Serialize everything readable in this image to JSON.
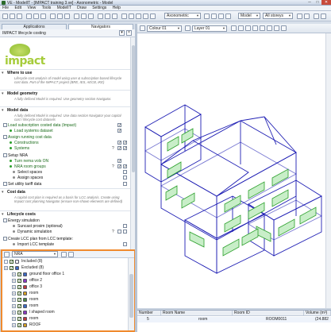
{
  "window": {
    "title": "VE - ModelIT - [IMPACT training 3.ve] - Axonometric - Model",
    "min": "─",
    "max": "□",
    "close": "✕"
  },
  "menu": [
    "File",
    "Edit",
    "View",
    "Tools",
    "ModelIT",
    "Draw",
    "Settings",
    "Help"
  ],
  "toolbar": {
    "view_combo": "Axonometric",
    "model_combo": "Model",
    "storey_combo": "All storeys",
    "colour_combo": "Colour 01",
    "layer_combo": "Layer 01"
  },
  "tabs": {
    "applications": "Applications",
    "navigators": "Navigators"
  },
  "panel": {
    "title": "IMPACT lifecycle costing"
  },
  "logo_text": "impact",
  "sections": {
    "where_to_use": {
      "title": "Where to use",
      "desc": "Lifecycle cost analysis of model using user & subscription based lifecycle cost data. Part of the IMPACT project (BRE, IES, AECB, IKE)"
    },
    "model_geometry": {
      "title": "Model geometry",
      "desc": "A fully defined Model is required. Use geometry section Navigator."
    },
    "model_data": {
      "title": "Model data",
      "desc": "A fully defined Model is required. Use data section Navigator your capital cost / lifecycle cost datasets",
      "load_subscription": "Load subscription costed data (Impact)",
      "load_systems": "Load systems dataset",
      "assign_running": "Assign running cost data",
      "constructions": "Constructions",
      "systems": "Systems"
    },
    "setup_nra": {
      "title": "Setup NRA",
      "turn_nra_on": "Turn nema vols ON",
      "nra_room_groups": "NRA room groups",
      "select_spaces": "Select spaces",
      "assign_spaces": "Assign spaces"
    },
    "utility_tariff": "Set utility tariff data",
    "cost_data": {
      "title": "Cost data",
      "desc": "A capital cost plan is required as a basis for LCC analysis. Create using Impact cost planning Navigator (ensure non-shown elements are defined)"
    },
    "lifecycle_costs": {
      "title": "Lifecycle costs",
      "energy_sim": "Energy simulation",
      "suncast": "Suncast prosim (optional)",
      "dynamic_sim": "Dynamic simulation",
      "create_lcc": "Create LCC plan from LCC template:",
      "import_lcc": "Import LCC template"
    }
  },
  "nav_panel": {
    "combo": "NRA",
    "tree": [
      {
        "label": "Included (8)",
        "level": 0,
        "checked": true
      },
      {
        "label": "Excluded (8)",
        "level": 0,
        "checked": true
      },
      {
        "label": "ground floor office 1",
        "level": 1,
        "checked": true
      },
      {
        "label": "office 2",
        "level": 1,
        "checked": true
      },
      {
        "label": "office 3",
        "level": 1,
        "checked": true
      },
      {
        "label": "room",
        "level": 1,
        "checked": true
      },
      {
        "label": "room",
        "level": 1,
        "checked": true
      },
      {
        "label": "room",
        "level": 1,
        "checked": true
      },
      {
        "label": "l shaped room",
        "level": 1,
        "checked": true
      },
      {
        "label": "room",
        "level": 1,
        "checked": true
      },
      {
        "label": "ROOF",
        "level": 1,
        "checked": true
      }
    ]
  },
  "table": {
    "headers": [
      "Number",
      "Room Name",
      "Room ID",
      "Volume (m³)"
    ],
    "row": [
      "5",
      "room",
      "ROOM0011",
      "(24.882"
    ]
  },
  "colors": {
    "highlight_border": "#f08a2e",
    "link_green": "#1a6b1a",
    "model_blue": "#1e1eb4",
    "model_green": "#2ca02c",
    "logo_green": "#a6cc3b"
  }
}
